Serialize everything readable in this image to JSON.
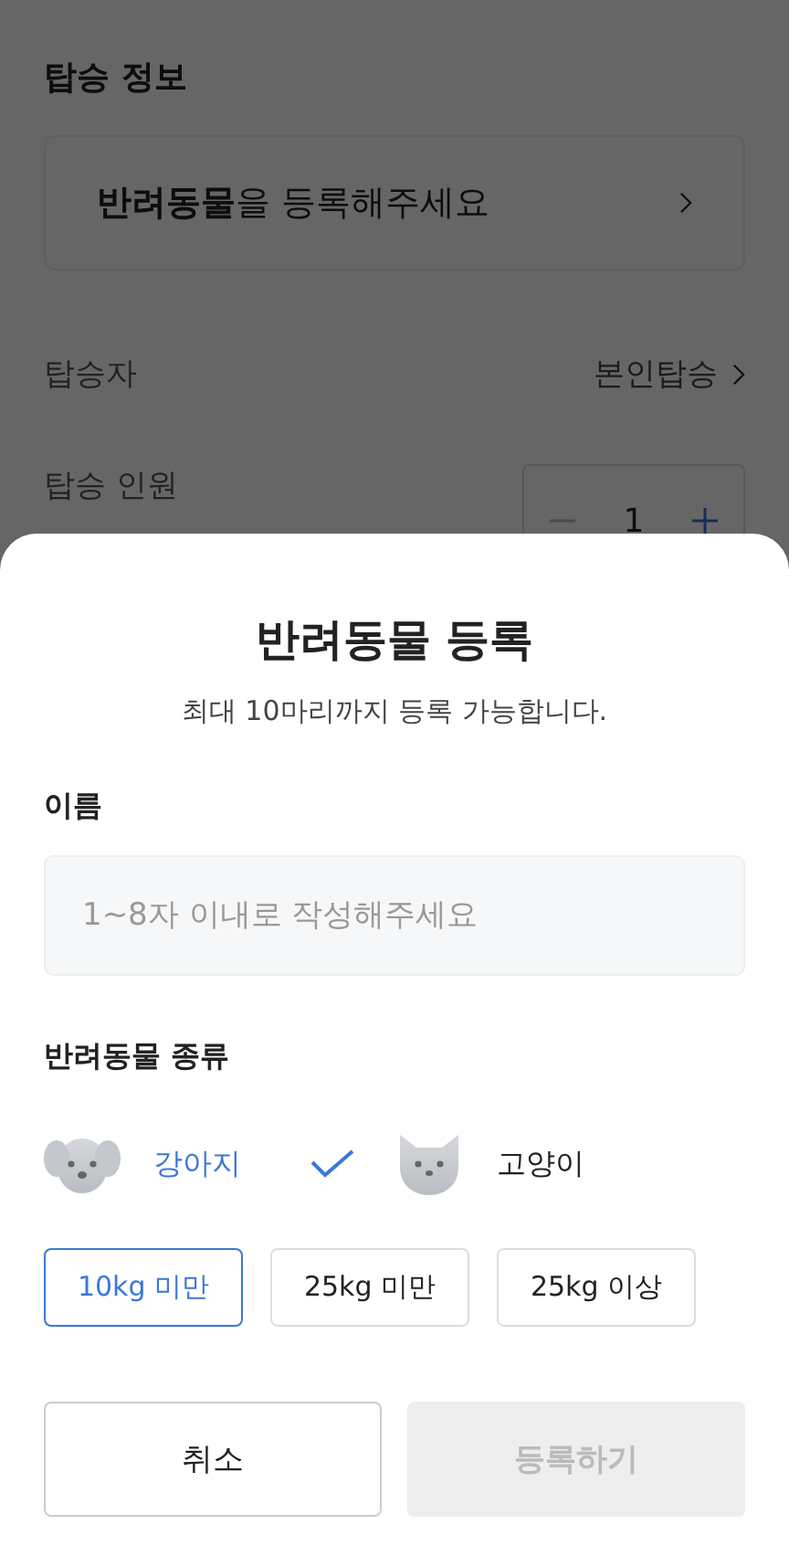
{
  "background": {
    "section_title": "탑승 정보",
    "pet_card": {
      "text": "**반려동물**을 등록해주세요"
    },
    "passenger": {
      "label": "탑승자",
      "value": "본인탑승"
    },
    "headcount": {
      "label": "탑승 인원",
      "count": "1"
    }
  },
  "sheet": {
    "title": "반려동물 등록",
    "subtitle": "최대 10마리까지 등록 가능합니다.",
    "name_label": "이름",
    "name_field": {
      "placeholder": "1~8자 이내로 작성해주세요"
    },
    "type_label": "반려동물 종류",
    "pet_types": [
      {
        "kind": "dog",
        "label": "강아지",
        "selected": true
      },
      {
        "kind": "cat",
        "label": "고양이",
        "selected": false
      }
    ],
    "weights": [
      {
        "label": "10kg 미만",
        "selected": true
      },
      {
        "label": "25kg 미만",
        "selected": false
      },
      {
        "label": "25kg 이상",
        "selected": false
      }
    ],
    "buttons": [
      {
        "label": "취소",
        "disabled": false
      },
      {
        "label": "등록하기",
        "disabled": true
      }
    ]
  }
}
